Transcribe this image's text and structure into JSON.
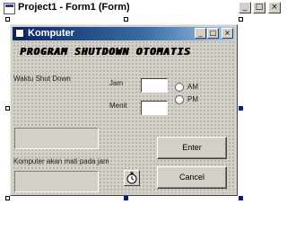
{
  "outer_window": {
    "title": "Project1 - Form1 (Form)",
    "buttons": {
      "minimize": "_",
      "restore": "□",
      "close": "×"
    }
  },
  "form": {
    "title": "Komputer",
    "buttons": {
      "minimize": "_",
      "restore": "□",
      "close": "×"
    },
    "heading": "PROGRAM SHUTDOWN OTOMATIS",
    "waktu_label": "Waktu Shut Down",
    "jam_label": "Jam",
    "menit_label": "Menit",
    "am_label": "AM",
    "pm_label": "PM",
    "jam_value": "",
    "menit_value": "",
    "info_label": "Komputer akan mati pada jam",
    "enter_label": "Enter",
    "cancel_label": "Cancel"
  },
  "icons": {
    "app": "vb-project-icon",
    "form": "form-icon",
    "timer": "stopwatch-icon"
  }
}
